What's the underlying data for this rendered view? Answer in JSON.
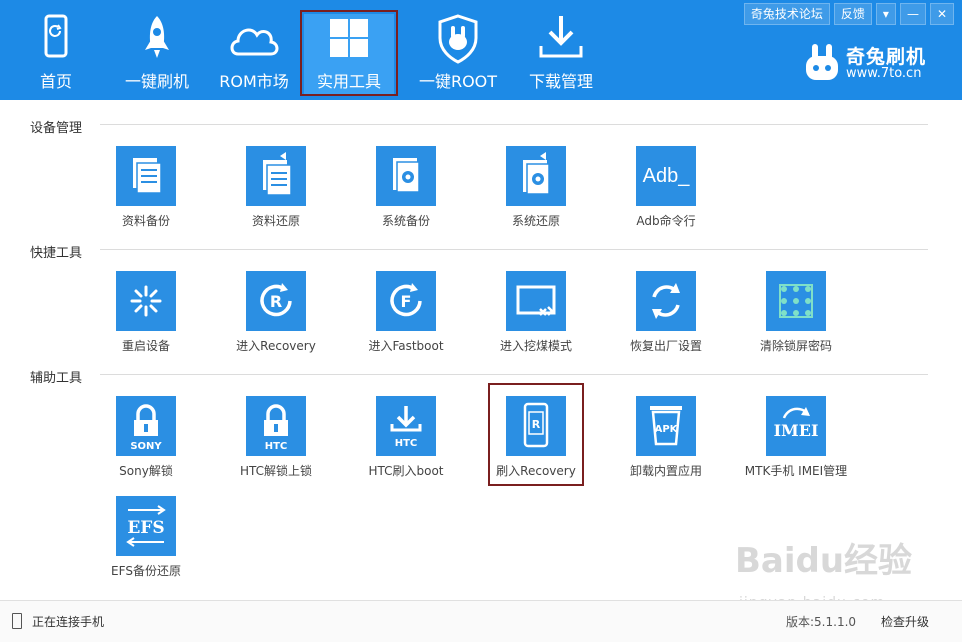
{
  "nav": {
    "home": "首页",
    "flash": "一键刷机",
    "rom": "ROM市场",
    "tools": "实用工具",
    "root": "一键ROOT",
    "download": "下载管理"
  },
  "toplinks": {
    "forum": "奇兔技术论坛",
    "feedback": "反馈",
    "menu": "▾",
    "minimize": "—",
    "close": "✕"
  },
  "brand": {
    "name": "奇兔刷机",
    "url": "www.7to.cn"
  },
  "sections": {
    "device": {
      "title": "设备管理",
      "items": [
        "资料备份",
        "资料还原",
        "系统备份",
        "系统还原",
        "Adb命令行"
      ]
    },
    "quick": {
      "title": "快捷工具",
      "items": [
        "重启设备",
        "进入Recovery",
        "进入Fastboot",
        "进入挖煤模式",
        "恢复出厂设置",
        "清除锁屏密码"
      ]
    },
    "aux": {
      "title": "辅助工具",
      "items": [
        "Sony解锁",
        "HTC解锁上锁",
        "HTC刷入boot",
        "刷入Recovery",
        "卸载内置应用",
        "MTK手机 IMEI管理",
        "EFS备份还原"
      ]
    }
  },
  "tile_icon_text": {
    "adb": "Adb_",
    "sony": "SONY",
    "htc": "HTC",
    "htc2": "HTC",
    "apk": "APK",
    "imei": "IMEI",
    "efs": "EFS",
    "r": "R",
    "f": "F"
  },
  "status": {
    "text": "正在连接手机",
    "version": "版本:5.1.1.0",
    "update": "检查升级"
  },
  "watermark": {
    "main": "Baidu经验",
    "sub": "jingyan.baidu.com"
  },
  "colors": {
    "topbar": "#1d8ae6",
    "tile": "#2b8fe3",
    "highlight": "#7a1f1f"
  }
}
